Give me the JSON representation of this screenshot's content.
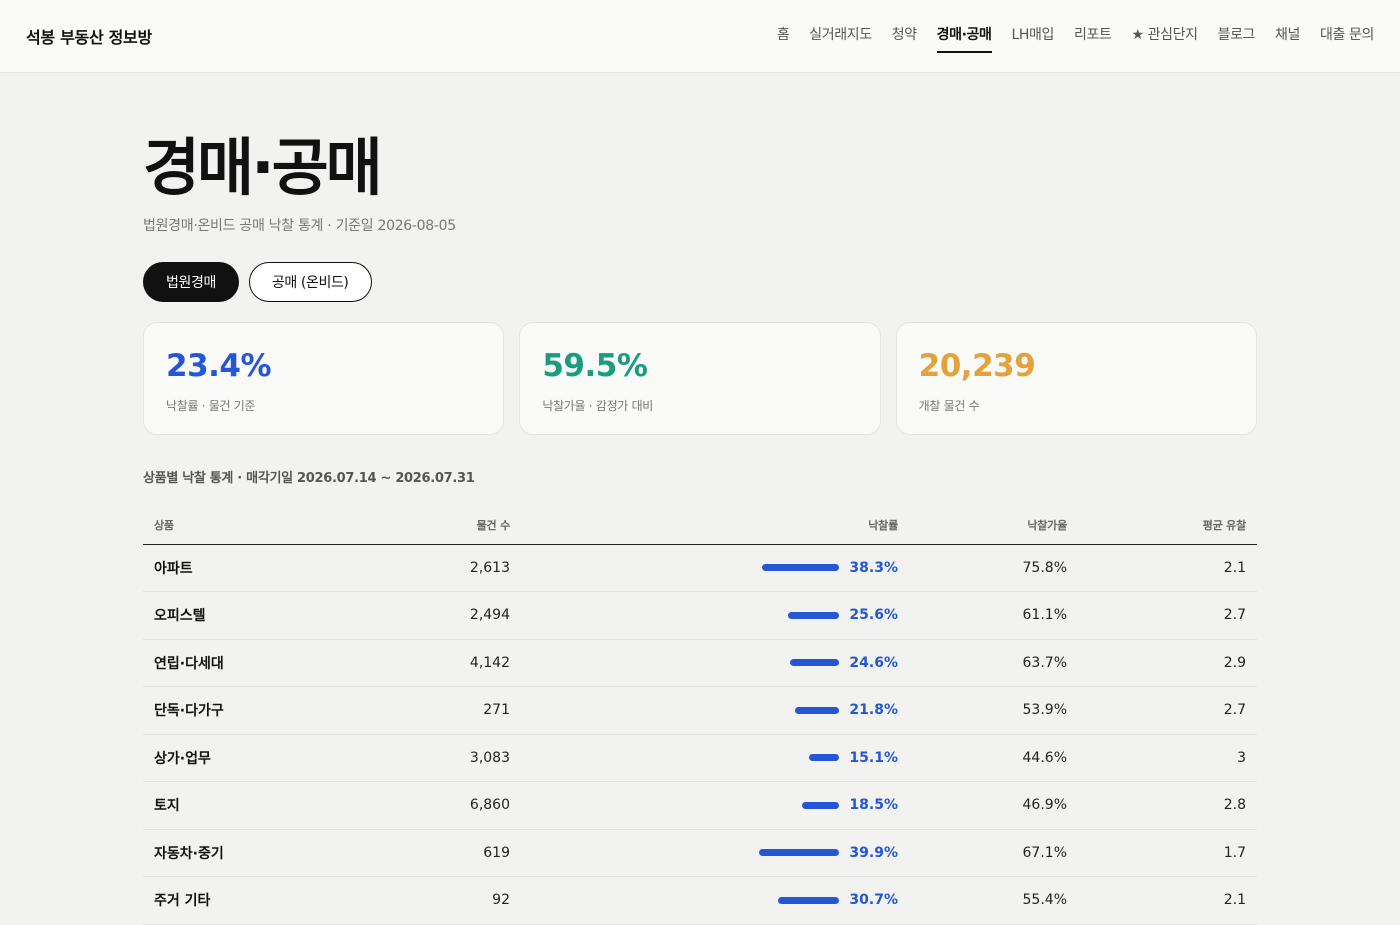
{
  "brand": "석봉 부동산 정보방",
  "nav": [
    "홈",
    "실거래지도",
    "청약",
    "경매·공매",
    "LH매입",
    "리포트",
    "★ 관심단지",
    "블로그",
    "채널",
    "대출 문의"
  ],
  "nav_active_index": 3,
  "page": {
    "title": "경매·공매",
    "subtitle": "법원경매·온비드 공매 낙찰 통계 · 기준일 2026-08-05"
  },
  "tabs": [
    {
      "label": "법원경매",
      "active": true
    },
    {
      "label": "공매 (온비드)",
      "active": false
    }
  ],
  "cards": [
    {
      "value": "23.4%",
      "label": "낙찰률 · 물건 기준",
      "color": "#2456d6"
    },
    {
      "value": "59.5%",
      "label": "낙찰가율 · 감정가 대비",
      "color": "#1a9c7e"
    },
    {
      "value": "20,239",
      "label": "개찰 물건 수",
      "color": "#e3a23b"
    }
  ],
  "section_title": "상품별 낙찰 통계 · 매각기일 2026.07.14 ~ 2026.07.31",
  "table": {
    "headers": [
      "상품",
      "물건 수",
      "낙찰률",
      "낙찰가율",
      "평균 유찰"
    ],
    "rows": [
      {
        "name": "아파트",
        "count": "2,613",
        "rate": 38.3,
        "ratio": "75.8%",
        "fail": "2.1"
      },
      {
        "name": "오피스텔",
        "count": "2,494",
        "rate": 25.6,
        "ratio": "61.1%",
        "fail": "2.7"
      },
      {
        "name": "연립·다세대",
        "count": "4,142",
        "rate": 24.6,
        "ratio": "63.7%",
        "fail": "2.9"
      },
      {
        "name": "단독·다가구",
        "count": "271",
        "rate": 21.8,
        "ratio": "53.9%",
        "fail": "2.7"
      },
      {
        "name": "상가·업무",
        "count": "3,083",
        "rate": 15.1,
        "ratio": "44.6%",
        "fail": "3"
      },
      {
        "name": "토지",
        "count": "6,860",
        "rate": 18.5,
        "ratio": "46.9%",
        "fail": "2.8"
      },
      {
        "name": "자동차·중기",
        "count": "619",
        "rate": 39.9,
        "ratio": "67.1%",
        "fail": "1.7"
      },
      {
        "name": "주거 기타",
        "count": "92",
        "rate": 30.7,
        "ratio": "55.4%",
        "fail": "2.1"
      }
    ]
  }
}
